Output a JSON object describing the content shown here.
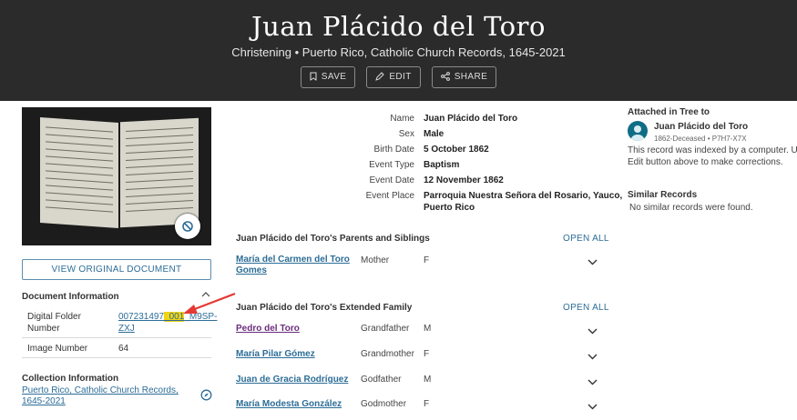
{
  "header": {
    "title": "Juan Plácido del Toro",
    "subtitle": "Christening • Puerto Rico, Catholic Church Records, 1645-2021",
    "buttons": {
      "save": "SAVE",
      "edit": "EDIT",
      "share": "SHARE"
    }
  },
  "left": {
    "view_original": "VIEW ORIGINAL DOCUMENT",
    "doc_info": {
      "heading": "Document Information",
      "digital_folder_label_1": "Digital Folder",
      "digital_folder_label_2": "Number",
      "folder_part_1": "007231497",
      "folder_part_2": "_001",
      "folder_part_3": "_M9SP-",
      "folder_part_4": "ZXJ",
      "image_number_label": "Image Number",
      "image_number_value": "64"
    },
    "collection": {
      "heading": "Collection Information",
      "link": "Puerto Rico, Catholic Church Records, 1645-2021"
    }
  },
  "details": {
    "name_label": "Name",
    "name_value": "Juan Plácido del Toro",
    "sex_label": "Sex",
    "sex_value": "Male",
    "birth_label": "Birth Date",
    "birth_value": "5 October 1862",
    "event_type_label": "Event Type",
    "event_type_value": "Baptism",
    "event_date_label": "Event Date",
    "event_date_value": "12 November 1862",
    "event_place_label": "Event Place",
    "event_place_line1": "Parroquia Nuestra Señora del Rosario, Yauco,",
    "event_place_line2": "Puerto Rico"
  },
  "parents": {
    "heading": "Juan Plácido del Toro's Parents and Siblings",
    "open_all": "OPEN ALL",
    "people": [
      {
        "name_line1": "María del Carmen del Toro",
        "name_line2": "Gomes",
        "relation": "Mother",
        "sex": "F"
      }
    ]
  },
  "extended": {
    "heading": "Juan Plácido del Toro's Extended Family",
    "open_all": "OPEN ALL",
    "people": [
      {
        "name": "Pedro del Toro",
        "relation": "Grandfather",
        "sex": "M"
      },
      {
        "name": "María Pilar Gómez",
        "relation": "Grandmother",
        "sex": "F"
      },
      {
        "name": "Juan de Gracia Rodríguez",
        "relation": "Godfather",
        "sex": "M"
      },
      {
        "name": "María Modesta González",
        "relation": "Godmother",
        "sex": "F"
      }
    ]
  },
  "right": {
    "attached_heading": "Attached in Tree to",
    "person_name": "Juan Plácido del Toro",
    "person_meta": "1862-Deceased • P7H7-X7X",
    "note_line1": "This record was indexed by a computer. Use",
    "note_line2": "Edit button above to make corrections.",
    "similar_heading": "Similar Records",
    "similar_text": "No similar records were found."
  },
  "colors": {
    "header_bg": "#2b2b2b",
    "link": "#2c6d97",
    "highlight": "#f1d414",
    "arrow": "#e53935"
  }
}
